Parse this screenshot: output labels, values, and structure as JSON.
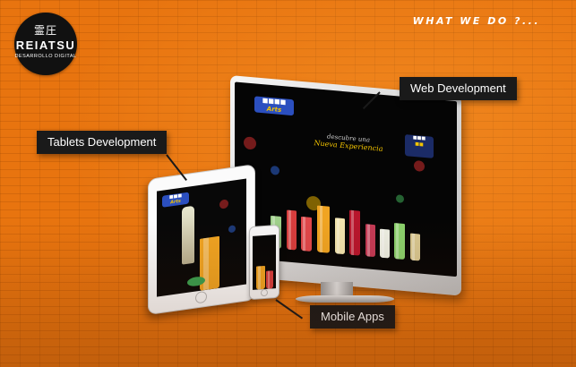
{
  "brand": {
    "kanji": "霊圧",
    "name": "REIATSU",
    "tagline": "DESARROLLO DIGITAL"
  },
  "headline": "WHAT WE DO ?...",
  "callouts": {
    "web": "Web Development",
    "tablets": "Tablets Development",
    "mobile": "Mobile Apps"
  },
  "site": {
    "tagline_top": "descubre una",
    "tagline_main": "Nueva Experiencia"
  },
  "colors": {
    "background": "#e8740f",
    "callout": "#1a1a1a"
  }
}
